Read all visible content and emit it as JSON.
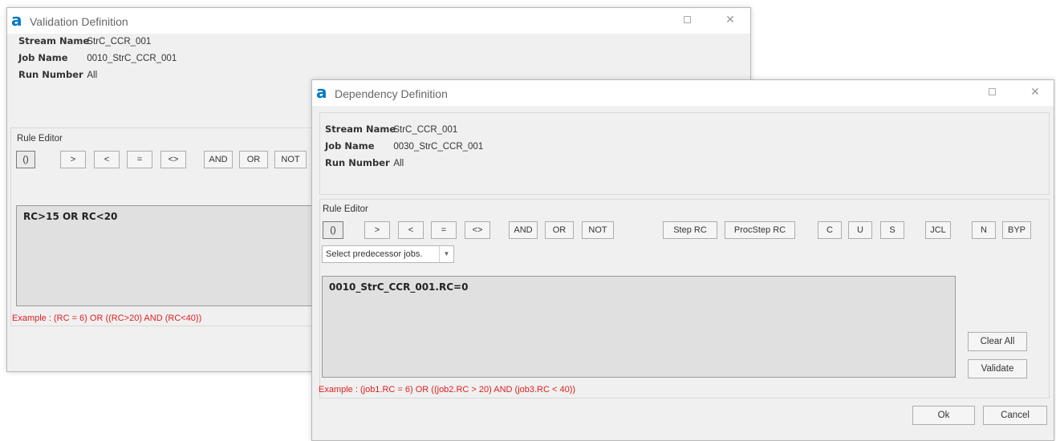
{
  "validation_window": {
    "title": "Validation Definition",
    "stream_label": "Stream Name",
    "stream_value": "StrC_CCR_001",
    "job_label": "Job Name",
    "job_value": "0010_StrC_CCR_001",
    "run_label": "Run Number",
    "run_value": "All",
    "rule_editor_label": "Rule Editor",
    "operators": [
      "()",
      ">",
      "<",
      "=",
      "<>",
      "AND",
      "OR",
      "NOT"
    ],
    "rule_text": "RC>15 OR RC<20",
    "example": "Example : (RC = 6) OR ((RC>20) AND (RC<40))"
  },
  "dependency_window": {
    "title": "Dependency Definition",
    "stream_label": "Stream Name",
    "stream_value": "StrC_CCR_001",
    "job_label": "Job Name",
    "job_value": "0030_StrC_CCR_001",
    "run_label": "Run Number",
    "run_value": "All",
    "rule_editor_label": "Rule Editor",
    "operators": [
      "()",
      ">",
      "<",
      "=",
      "<>",
      "AND",
      "OR",
      "NOT"
    ],
    "extra_buttons": [
      "Step RC",
      "ProcStep RC",
      "C",
      "U",
      "S",
      "JCL",
      "N",
      "BYP"
    ],
    "predecessor_placeholder": "Select predecessor jobs.",
    "rule_text": "0010_StrC_CCR_001.RC=0",
    "clear_all_label": "Clear All",
    "validate_label": "Validate",
    "example": "Example : (job1.RC = 6) OR ((job2.RC > 20) AND (job3.RC < 40))",
    "ok_label": "Ok",
    "cancel_label": "Cancel"
  },
  "colors": {
    "logo": "#0079c1",
    "example_text": "#e02020",
    "rule_box_bg": "#e0e0e0"
  },
  "icons": {
    "logo": "app-logo-icon",
    "maximize": "maximize-icon",
    "close": "close-icon",
    "dropdown": "chevron-down-icon"
  }
}
